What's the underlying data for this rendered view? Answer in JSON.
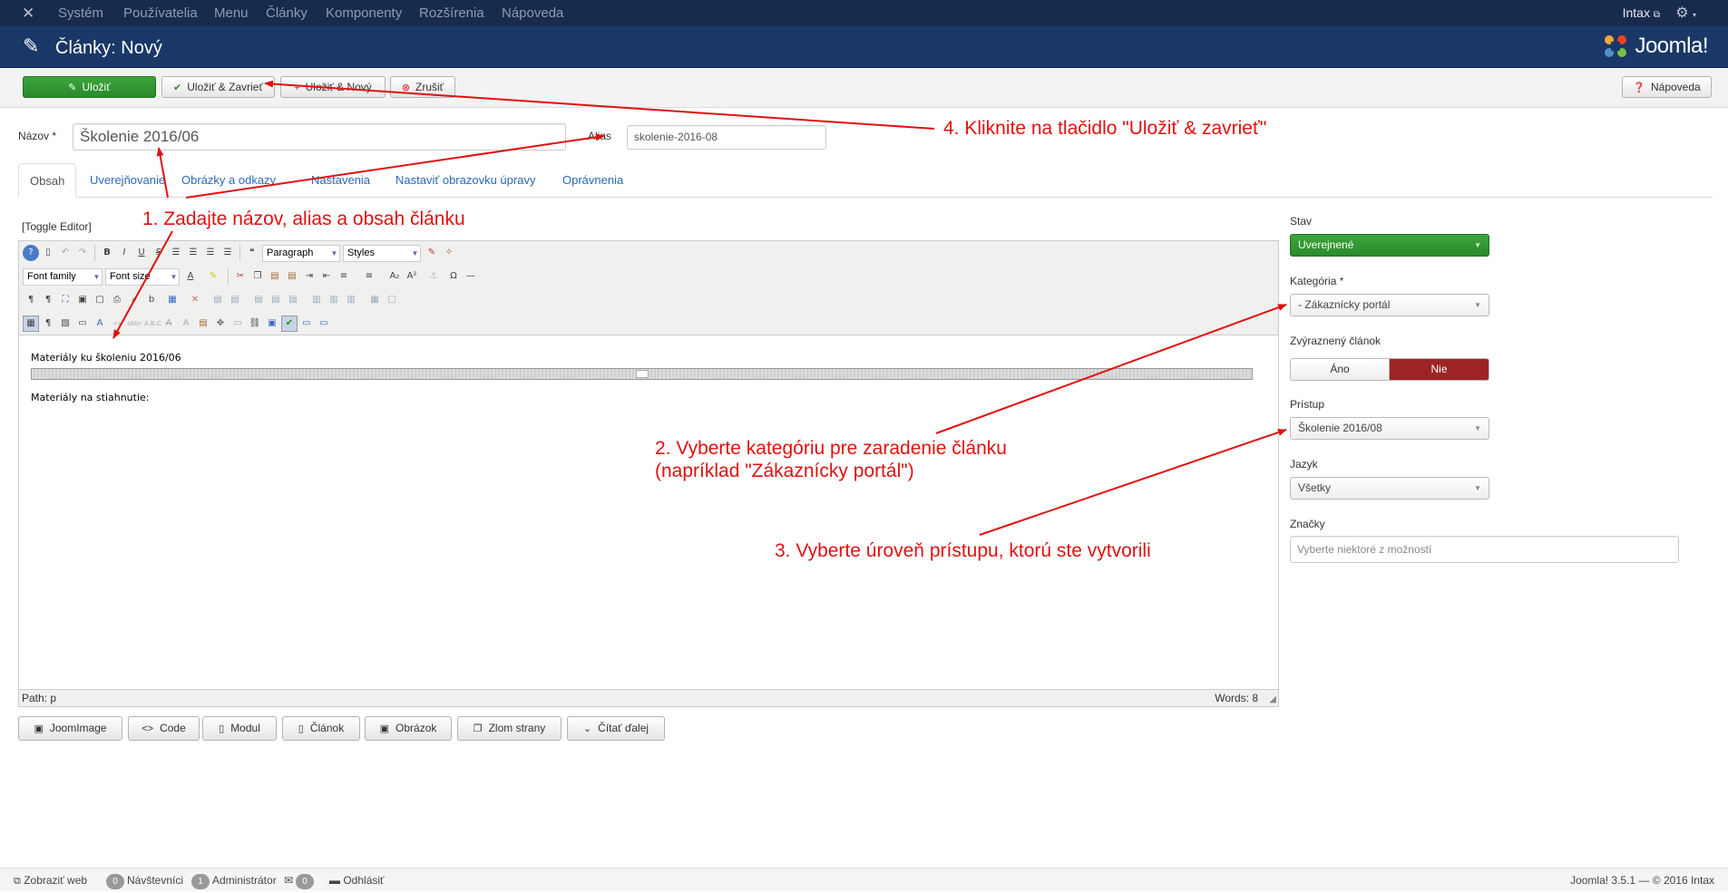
{
  "topnav": {
    "logo_icon": "joomla-icon",
    "items": [
      "Systém",
      "Používatelia",
      "Menu",
      "Články",
      "Komponenty",
      "Rozšírenia",
      "Nápoveda"
    ],
    "user": "Intax",
    "settings_icon": "gear-icon"
  },
  "header": {
    "title": "Články: Nový",
    "brand": "Joomla!"
  },
  "toolbar": {
    "save": "Uložiť",
    "save_close": "Uložiť & Zavrieť",
    "save_new": "Uložiť & Nový",
    "cancel": "Zrušiť",
    "help": "Nápoveda"
  },
  "form": {
    "title_label": "Názov *",
    "title_value": "Školenie 2016/06",
    "alias_label": "Alias",
    "alias_value": "skolenie-2016-08"
  },
  "tabs": [
    "Obsah",
    "Uverejňovanie",
    "Obrázky a odkazy",
    "Nastavenia",
    "Nastaviť obrazovku úpravy",
    "Oprávnenia"
  ],
  "editor": {
    "toggle": "[Toggle Editor]",
    "format_select": "Paragraph",
    "styles_select": "Styles",
    "font_family": "Font family",
    "font_size": "Font size",
    "paragraph1": "Materiály ku školeniu 2016/06",
    "paragraph2": "Materiály na stiahnutie:",
    "path": "Path: p",
    "words": "Words: 8"
  },
  "editor_buttons": [
    "JoomImage",
    "Code",
    "Modul",
    "Článok",
    "Obrázok",
    "Zlom strany",
    "Čítať ďalej"
  ],
  "sidebar": {
    "stav_label": "Stav",
    "stav_value": "Uverejnené",
    "kategoria_label": "Kategória *",
    "kategoria_value": "- Zákaznícky portál",
    "featured_label": "Zvýraznený článok",
    "featured_yes": "Áno",
    "featured_no": "Nie",
    "pristup_label": "Prístup",
    "pristup_value": "Školenie 2016/08",
    "jazyk_label": "Jazyk",
    "jazyk_value": "Všetky",
    "tags_label": "Značky",
    "tags_placeholder": "Vyberte niektoré z možností"
  },
  "annotations": {
    "a1": "1. Zadajte názov, alias a obsah článku",
    "a2_line1": "2. Vyberte kategóriu pre zaradenie článku",
    "a2_line2": "(napríklad \"Zákaznícky portál\")",
    "a3": "3. Vyberte úroveň prístupu, ktorú ste vytvorili",
    "a4": "4. Kliknite na tlačidlo \"Uložiť & zavrieť\""
  },
  "status": {
    "view_site": "Zobraziť web",
    "visitors_count": "0",
    "visitors": "Návštevníci",
    "admins_count": "1",
    "admins": "Administrátor",
    "messages_count": "0",
    "logout": "Odhlásiť",
    "version": "Joomla! 3.5.1  —  © 2016 Intax"
  },
  "colors": {
    "nav_bg": "#172b4d",
    "header_bg": "#1a3867",
    "success": "#2f962f",
    "danger": "#9c2424",
    "annotation": "#e01010",
    "link": "#2a69b8"
  }
}
